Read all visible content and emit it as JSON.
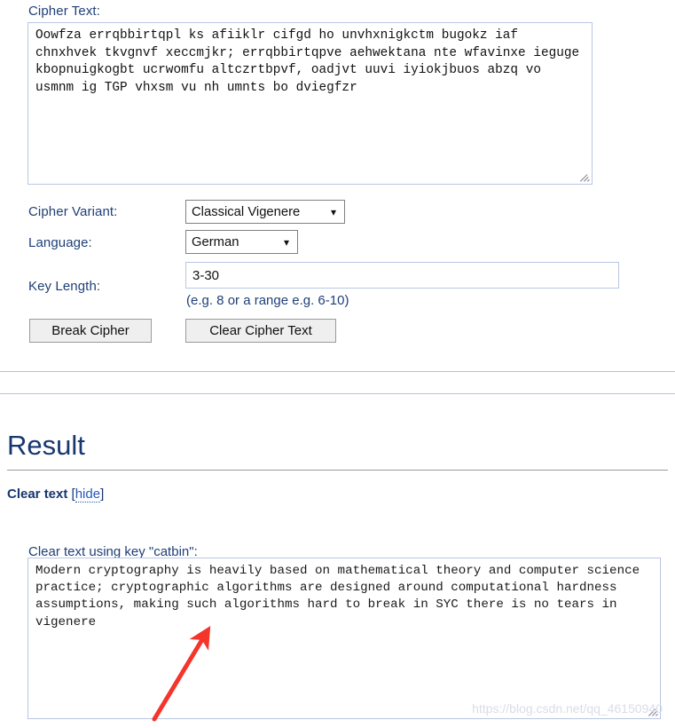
{
  "form": {
    "cipher_text_label": "Cipher Text:",
    "cipher_text_value": "Oowfza errqbbirtqpl ks afiiklr cifgd ho unvhxnigkctm bugokz iaf chnxhvek tkvgnvf xeccmjkr; errqbbirtqpve aehwektana nte wfavinxe ieguge kbopnuigkogbt ucrwomfu altczrtbpvf, oadjvt uuvi iyiokjbuos abzq vo usmnm ig TGP vhxsm vu nh umnts bo dviegfzr",
    "cipher_variant_label": "Cipher Variant:",
    "cipher_variant_value": "Classical Vigenere",
    "language_label": "Language:",
    "language_value": "German",
    "key_length_label": "Key Length:",
    "key_length_value": "3-30",
    "key_length_hint": "(e.g. 8 or a range e.g. 6-10)",
    "break_cipher_label": "Break Cipher",
    "clear_cipher_label": "Clear Cipher Text"
  },
  "result": {
    "heading": "Result",
    "clear_text_label": "Clear text",
    "hide_open_bracket": "[",
    "hide_link_label": "hide",
    "hide_close_bracket": "]",
    "clear_text_subtitle": "Clear text using key \"catbin\":",
    "clear_text_value": "Modern cryptography is heavily based on mathematical theory and computer science practice; cryptographic algorithms are designed around computational hardness assumptions, making such algorithms hard to break in SYC there is no tears in vigenere"
  },
  "watermark": {
    "text": "https://blog.csdn.net/qq_46150940"
  },
  "colors": {
    "label_blue": "#1f3f77",
    "heading_navy": "#17376e",
    "link_blue": "#2558b8",
    "input_border": "#b9c6e2",
    "separator_blue": "#b4c4e4",
    "button_bg": "#efefef",
    "arrow_red": "#f4352c"
  }
}
